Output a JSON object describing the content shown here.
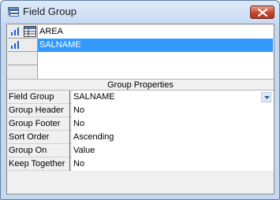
{
  "window": {
    "title": "Field Group"
  },
  "field_list": {
    "items": [
      {
        "label": "AREA",
        "selected": false
      },
      {
        "label": "SALNAME",
        "selected": true
      }
    ]
  },
  "properties": {
    "section_title": "Group Properties",
    "rows": [
      {
        "name": "Field Group",
        "value": "SALNAME"
      },
      {
        "name": "Group Header",
        "value": "No"
      },
      {
        "name": "Group Footer",
        "value": "No"
      },
      {
        "name": "Sort Order",
        "value": "Ascending"
      },
      {
        "name": "Group On",
        "value": "Value"
      },
      {
        "name": "Keep Together",
        "value": "No"
      }
    ]
  },
  "icons": {
    "title": "field-group-icon",
    "close": "close-icon",
    "row_handle": "bar-chart-icon",
    "grouping": "grid-icon",
    "dropdown": "chevron-down-icon"
  },
  "colors": {
    "selection": "#3399ff",
    "close_button": "#c6452c",
    "titlebar": "#c9dbf1"
  }
}
